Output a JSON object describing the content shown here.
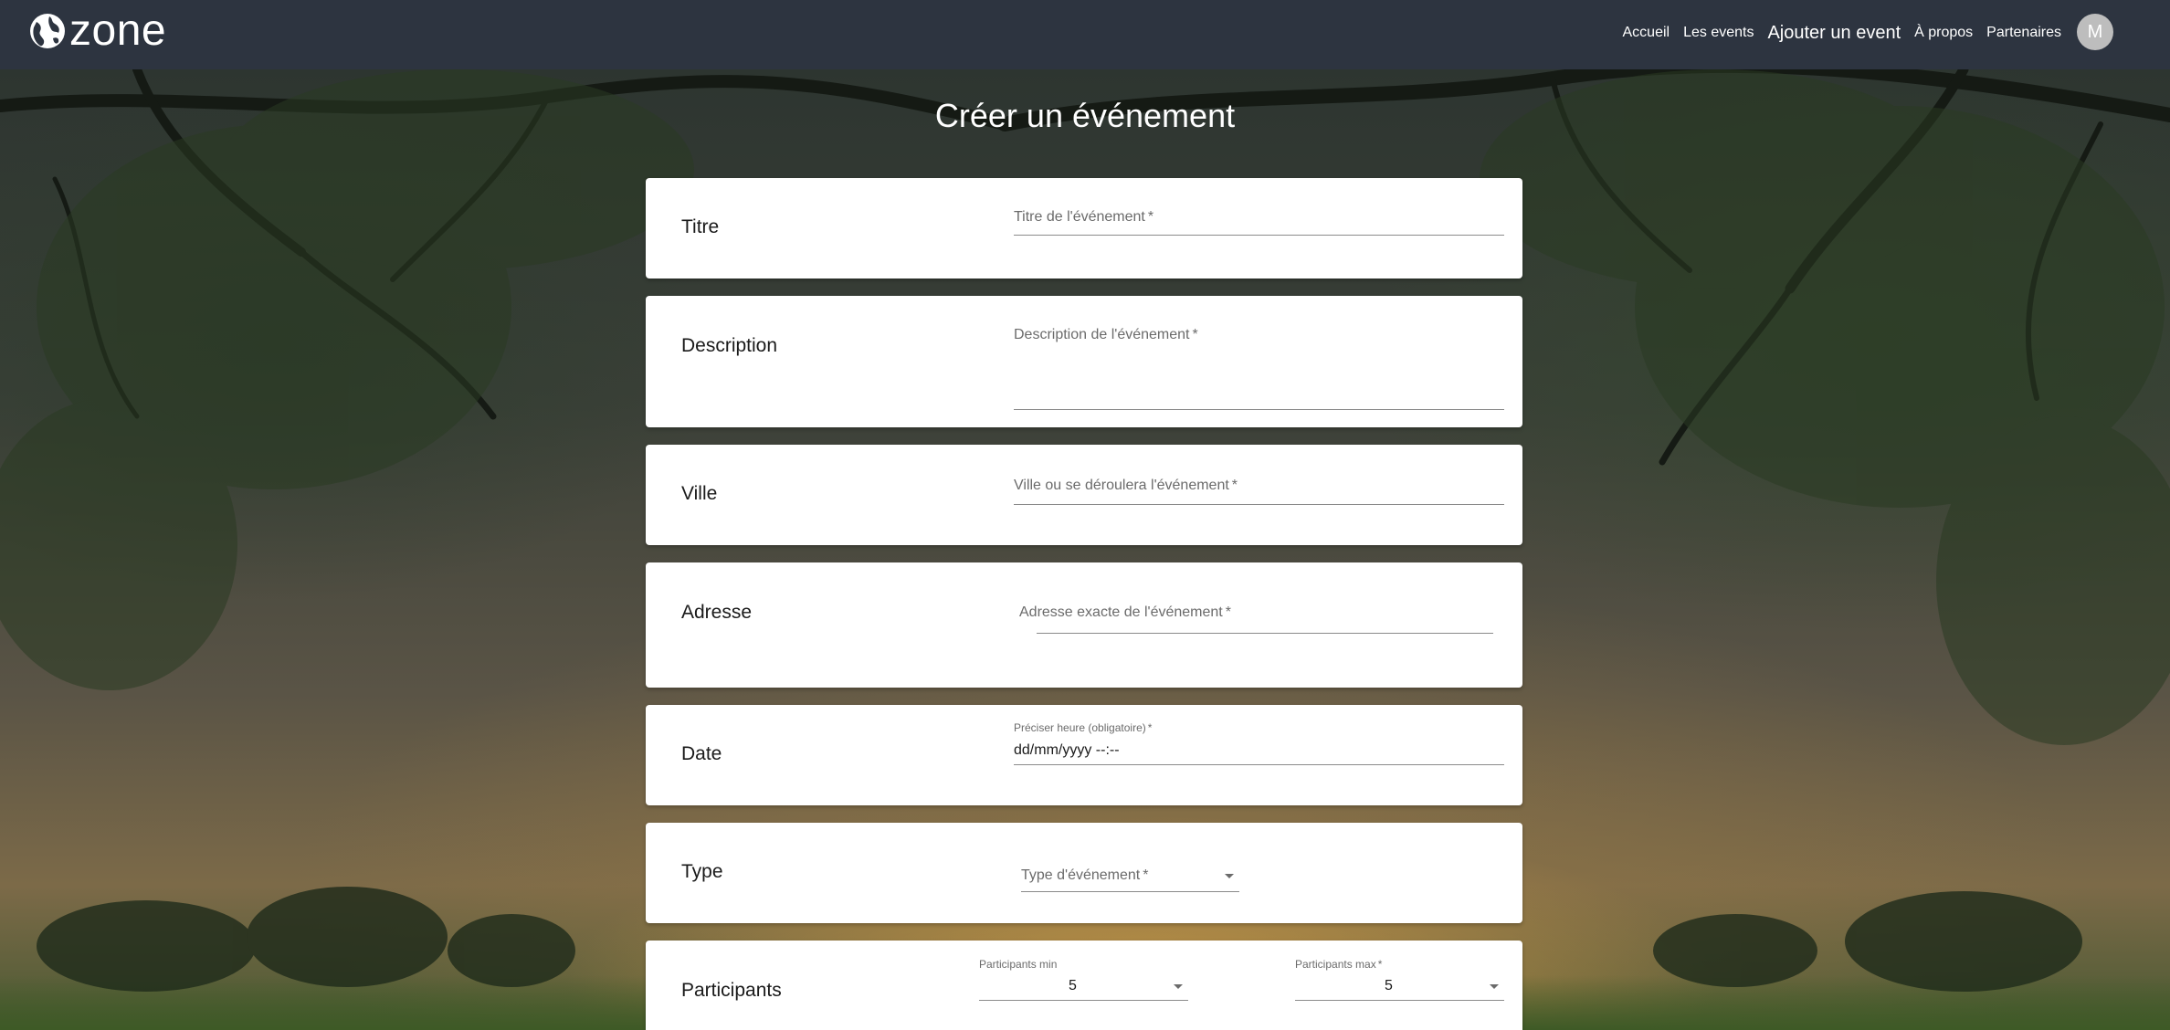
{
  "nav": {
    "logo_text": "zone",
    "links": [
      "Accueil",
      "Les events",
      "Ajouter un event",
      "À propos",
      "Partenaires"
    ],
    "avatar_initial": "M"
  },
  "page": {
    "title": "Créer un événement"
  },
  "form": {
    "title": {
      "label": "Titre",
      "placeholder": "Titre de l'événement",
      "required": "*"
    },
    "description": {
      "label": "Description",
      "placeholder": "Description de l'événement",
      "required": "*"
    },
    "city": {
      "label": "Ville",
      "placeholder": "Ville ou se déroulera l'événement",
      "required": "*"
    },
    "address": {
      "label": "Adresse",
      "placeholder": "Adresse exacte de l'événement",
      "required": "*"
    },
    "date": {
      "label": "Date",
      "hint": "Préciser heure (obligatoire)",
      "required": "*",
      "value": "dd/mm/yyyy --:--"
    },
    "type": {
      "label": "Type",
      "placeholder": "Type d'événement",
      "required": "*"
    },
    "participants": {
      "label": "Participants",
      "min_label": "Participants min",
      "min_value": "5",
      "max_label": "Participants max",
      "max_required": "*",
      "max_value": "5"
    }
  }
}
